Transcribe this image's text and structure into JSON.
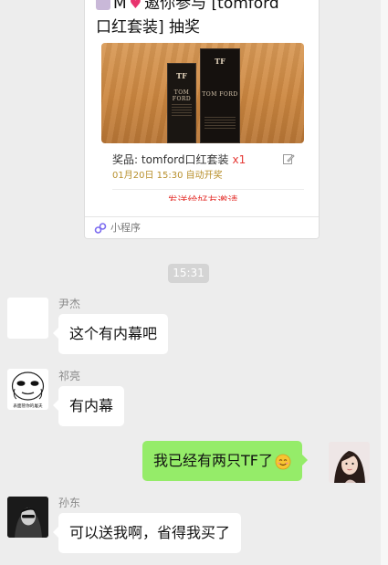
{
  "mini_program_card": {
    "title_prefix": "M",
    "title_line1": "邀你参与 [tomford",
    "title_line2": "口红套装] 抽奖",
    "box_brand_small": "TOM FORD",
    "box_brand_large": "TOM FORD",
    "box_tf": "TF",
    "prize_label": "奖品: tomford口红套装",
    "prize_qty": "x1",
    "draw_time": "01月20日 15:30 自动开奖",
    "invite_text": "发送给好友邀请",
    "footer_label": "小程序",
    "footer_icon": "mini-program-icon"
  },
  "timestamp": "15:31",
  "messages": [
    {
      "sender": "尹杰",
      "text": "这个有内幕吧",
      "direction": "incoming"
    },
    {
      "sender": "祁亮",
      "text": "有内幕",
      "direction": "incoming",
      "avatar_caption": "表面管你的屠夫"
    },
    {
      "sender": "",
      "text": "我已经有两只TF了",
      "direction": "outgoing",
      "emoji": "smiling-face-emoji"
    },
    {
      "sender": "孙东",
      "text": "可以送我啊，省得我买了",
      "direction": "incoming"
    }
  ],
  "colors": {
    "background": "#ededed",
    "incoming_bubble": "#ffffff",
    "outgoing_bubble": "#95ec69",
    "accent_red": "#e53935",
    "draw_time": "#b8902d"
  }
}
